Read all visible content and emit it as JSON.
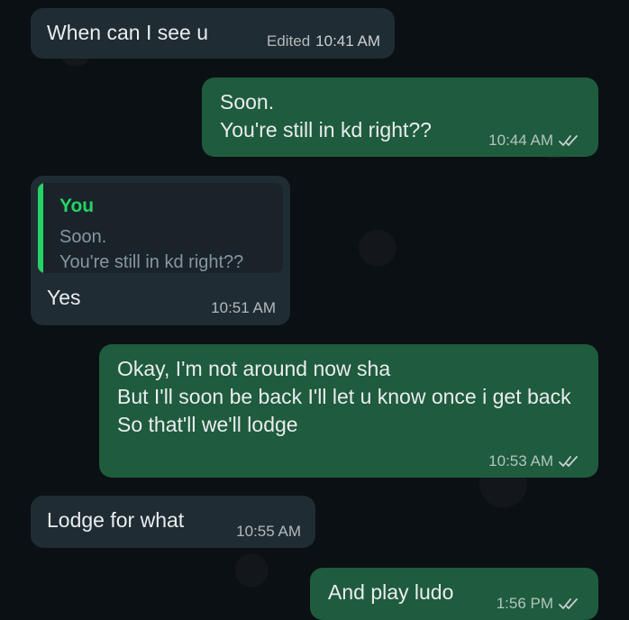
{
  "messages": [
    {
      "direction": "incoming",
      "text": "When can I see u",
      "edited_label": "Edited",
      "time": "10:41 AM"
    },
    {
      "direction": "outgoing",
      "text": "Soon.\nYou're still in kd right??",
      "time": "10:44 AM",
      "status": "read"
    },
    {
      "direction": "incoming",
      "reply_author": "You",
      "reply_text": "Soon.\nYou're still in kd right??",
      "text": "Yes",
      "time": "10:51 AM"
    },
    {
      "direction": "outgoing",
      "text": "Okay, I'm not around now sha\nBut I'll soon be back I'll let u know once i get back\nSo that'll we'll lodge",
      "time": "10:53 AM",
      "status": "read"
    },
    {
      "direction": "incoming",
      "text": "Lodge for what",
      "time": "10:55 AM"
    },
    {
      "direction": "outgoing",
      "text": "And play ludo",
      "time": "1:56 PM",
      "status": "read"
    }
  ],
  "colors": {
    "background": "#0b1014",
    "incoming_bubble": "#202c33",
    "outgoing_bubble": "#1f5b3d",
    "reply_accent": "#25d366",
    "read_ticks": "#c9d1d6"
  },
  "icons": {
    "read_receipt": "double-check-icon"
  }
}
